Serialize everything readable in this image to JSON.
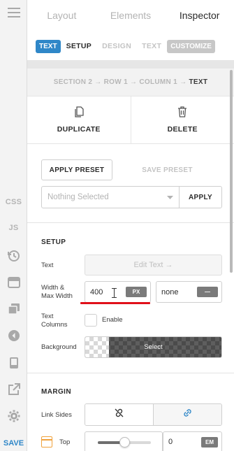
{
  "tabs": [
    {
      "label": "Layout",
      "active": false
    },
    {
      "label": "Elements",
      "active": false
    },
    {
      "label": "Inspector",
      "active": true
    }
  ],
  "subtabs": {
    "element_badge": "TEXT",
    "items": [
      "SETUP",
      "DESIGN",
      "TEXT"
    ],
    "active": "SETUP",
    "customize": "CUSTOMIZE"
  },
  "breadcrumb": {
    "path": "SECTION 2 → ROW 1 → COLUMN 1 →",
    "current": "TEXT"
  },
  "actions": {
    "duplicate": "DUPLICATE",
    "delete": "DELETE"
  },
  "presets": {
    "apply_preset": "APPLY PRESET",
    "save_preset": "SAVE PRESET",
    "select_placeholder": "Nothing Selected",
    "apply": "APPLY"
  },
  "setup": {
    "title": "SETUP",
    "text_label": "Text",
    "edit_text": "Edit Text →",
    "width_label_1": "Width &",
    "width_label_2": "Max Width",
    "width_value": "400",
    "width_unit": "PX",
    "max_width_value": "none",
    "max_width_unit": "—",
    "columns_label_1": "Text",
    "columns_label_2": "Columns",
    "enable_label": "Enable",
    "background_label": "Background",
    "background_select": "Select"
  },
  "margin": {
    "title": "MARGIN",
    "link_sides_label": "Link Sides",
    "top_label": "Top",
    "top_value": "0",
    "top_unit": "EM",
    "top_slider": 0.5
  },
  "rail": {
    "css": "CSS",
    "js": "JS",
    "save": "SAVE"
  },
  "colors": {
    "accent": "#2f87c8",
    "highlight_line": "#e0101a",
    "top_icon": "#f0a23c"
  }
}
